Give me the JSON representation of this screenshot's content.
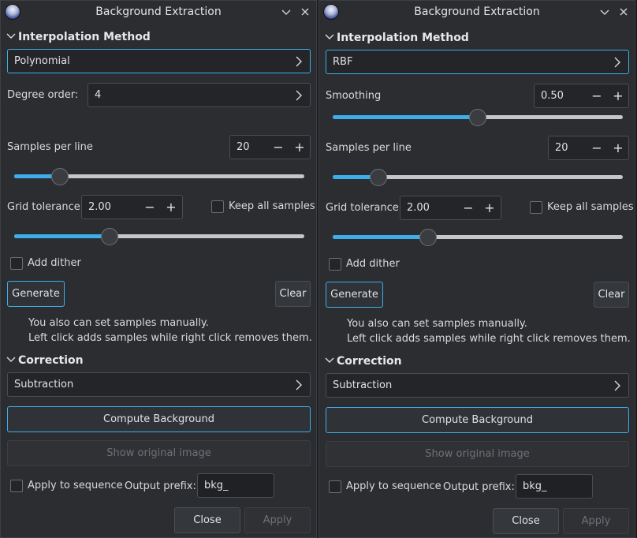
{
  "left": {
    "title": "Background Extraction",
    "interpolation_heading": "Interpolation Method",
    "method": "Polynomial",
    "degree_label": "Degree order:",
    "degree_value": "4",
    "samples_label": "Samples per line",
    "samples_value": "20",
    "samples_slider_fraction": 0.158,
    "grid_label": "Grid tolerance",
    "grid_value": "2.00",
    "keep_samples_label": "Keep all samples",
    "grid_slider_fraction": 0.33,
    "dither_label": "Add dither",
    "generate_label": "Generate",
    "clear_label": "Clear",
    "info_line1": "You also can set samples manually.",
    "info_line2": "Left click adds samples while right click removes them.",
    "correction_heading": "Correction",
    "correction_value": "Subtraction",
    "compute_label": "Compute Background",
    "show_original_label": "Show original image",
    "apply_seq_label": "Apply to sequence",
    "prefix_label": "Output prefix:",
    "prefix_value": "bkg_",
    "close_label": "Close",
    "apply_label": "Apply"
  },
  "right": {
    "title": "Background Extraction",
    "interpolation_heading": "Interpolation Method",
    "method": "RBF",
    "smoothing_label": "Smoothing",
    "smoothing_value": "0.50",
    "smoothing_slider_fraction": 0.5,
    "samples_label": "Samples per line",
    "samples_value": "20",
    "samples_slider_fraction": 0.158,
    "grid_label": "Grid tolerance",
    "grid_value": "2.00",
    "keep_samples_label": "Keep all samples",
    "grid_slider_fraction": 0.33,
    "dither_label": "Add dither",
    "generate_label": "Generate",
    "clear_label": "Clear",
    "info_line1": "You also can set samples manually.",
    "info_line2": "Left click adds samples while right click removes them.",
    "correction_heading": "Correction",
    "correction_value": "Subtraction",
    "compute_label": "Compute Background",
    "show_original_label": "Show original image",
    "apply_seq_label": "Apply to sequence",
    "prefix_label": "Output prefix:",
    "prefix_value": "bkg_",
    "close_label": "Close",
    "apply_label": "Apply"
  },
  "icons": {
    "app": "siril-app-icon",
    "minimize": "chevron-down-icon",
    "close": "close-icon",
    "section_expander": "chevron-down-icon",
    "combo_arrow": "chevron-right-icon"
  },
  "colors": {
    "accent": "#3daee9",
    "window_bg": "#2b2d31",
    "field_bg": "#232529",
    "disabled_text": "#6e7176"
  }
}
